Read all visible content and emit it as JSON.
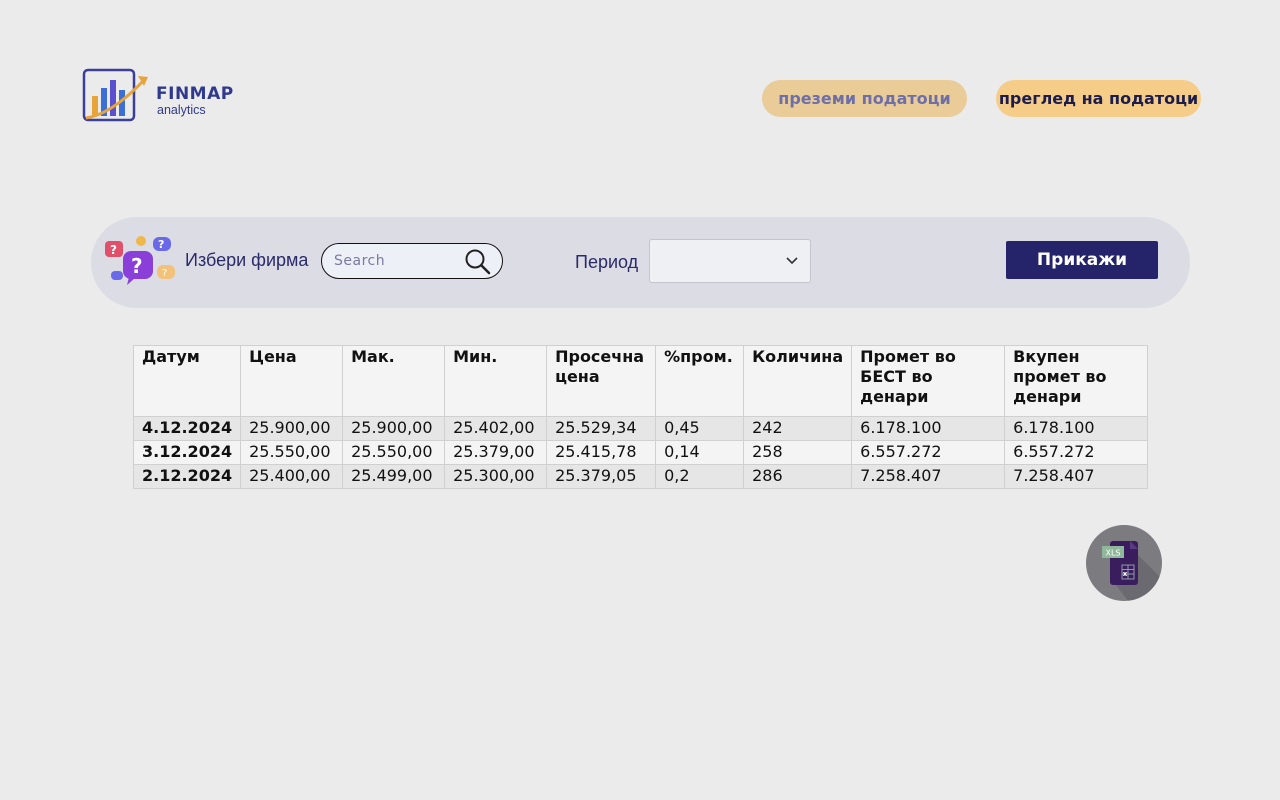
{
  "brand": {
    "name": "FINMAP",
    "tagline": "analytics"
  },
  "nav": {
    "download_label": "преземи податоци",
    "view_label": "преглед на податоци"
  },
  "filter": {
    "firm_label": "Избери фирма",
    "search_placeholder": "Search",
    "search_value": "",
    "period_label": "Период",
    "period_value": "",
    "submit_label": "Прикажи"
  },
  "table": {
    "headers": [
      "Датум",
      "Цена",
      "Мак.",
      "Мин.",
      "Просечна цена",
      "%пром.",
      "Количина",
      "Промет во БЕСТ во денари",
      "Вкупен промет во денари"
    ],
    "rows": [
      [
        "4.12.2024",
        "25.900,00",
        "25.900,00",
        "25.402,00",
        "25.529,34",
        "0,45",
        "242",
        "6.178.100",
        "6.178.100"
      ],
      [
        "3.12.2024",
        "25.550,00",
        "25.550,00",
        "25.379,00",
        "25.415,78",
        "0,14",
        "258",
        "6.557.272",
        "6.557.272"
      ],
      [
        "2.12.2024",
        "25.400,00",
        "25.499,00",
        "25.300,00",
        "25.379,05",
        "0,2",
        "286",
        "7.258.407",
        "7.258.407"
      ]
    ]
  },
  "export": {
    "badge": "XLS",
    "icon": "excel-file-icon"
  },
  "colors": {
    "background": "#ebebeb",
    "brand": "#2f3a8f",
    "primary_button": "#25236a",
    "pill_download": "#e9cc98",
    "pill_view": "#f6cd88",
    "filter_bar": "#dcdce4"
  }
}
